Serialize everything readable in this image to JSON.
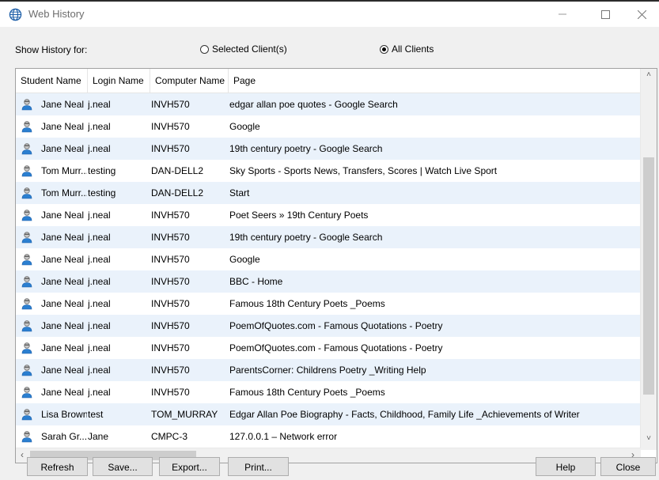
{
  "window": {
    "title": "Web History"
  },
  "filter": {
    "label": "Show History for:",
    "options": [
      {
        "label": "Selected Client(s)",
        "checked": false
      },
      {
        "label": "All Clients",
        "checked": true
      }
    ]
  },
  "table": {
    "columns": [
      "Student Name",
      "Login Name",
      "Computer Name",
      "Page"
    ],
    "rows": [
      [
        "Jane Neal",
        "j.neal",
        "INVH570",
        "edgar allan poe quotes - Google Search"
      ],
      [
        "Jane Neal",
        "j.neal",
        "INVH570",
        "Google"
      ],
      [
        "Jane Neal",
        "j.neal",
        "INVH570",
        "19th century poetry - Google Search"
      ],
      [
        "Tom Murr...",
        "testing",
        "DAN-DELL2",
        "Sky Sports - Sports News, Transfers, Scores | Watch Live Sport"
      ],
      [
        "Tom Murr...",
        "testing",
        "DAN-DELL2",
        "Start"
      ],
      [
        "Jane Neal",
        "j.neal",
        "INVH570",
        "Poet Seers » 19th Century Poets"
      ],
      [
        "Jane Neal",
        "j.neal",
        "INVH570",
        "19th century poetry - Google Search"
      ],
      [
        "Jane Neal",
        "j.neal",
        "INVH570",
        "Google"
      ],
      [
        "Jane Neal",
        "j.neal",
        "INVH570",
        "BBC - Home"
      ],
      [
        "Jane Neal",
        "j.neal",
        "INVH570",
        "Famous 18th Century Poets _Poems"
      ],
      [
        "Jane Neal",
        "j.neal",
        "INVH570",
        "PoemOfQuotes.com - Famous Quotations - Poetry"
      ],
      [
        "Jane Neal",
        "j.neal",
        "INVH570",
        "PoemOfQuotes.com - Famous Quotations - Poetry"
      ],
      [
        "Jane Neal",
        "j.neal",
        "INVH570",
        "ParentsCorner: Childrens Poetry _Writing Help"
      ],
      [
        "Jane Neal",
        "j.neal",
        "INVH570",
        "Famous 18th Century Poets _Poems"
      ],
      [
        "Lisa Brown",
        "test",
        "TOM_MURRAY",
        "Edgar Allan Poe Biography - Facts, Childhood, Family Life _Achievements of Writer"
      ],
      [
        "Sarah Gr...",
        "Jane",
        "CMPC-3",
        "127.0.0.1 – Network error"
      ]
    ]
  },
  "buttons": {
    "refresh": "Refresh",
    "save": "Save...",
    "export": "Export...",
    "print": "Print...",
    "help": "Help",
    "close": "Close"
  },
  "icons": {
    "title": "globe-icon",
    "row": "user-icon",
    "minimize": "minimize-icon",
    "maximize": "maximize-icon",
    "close": "close-icon"
  },
  "colors": {
    "row_alt": "#eaf2fb",
    "icon_accent": "#1e73be"
  }
}
